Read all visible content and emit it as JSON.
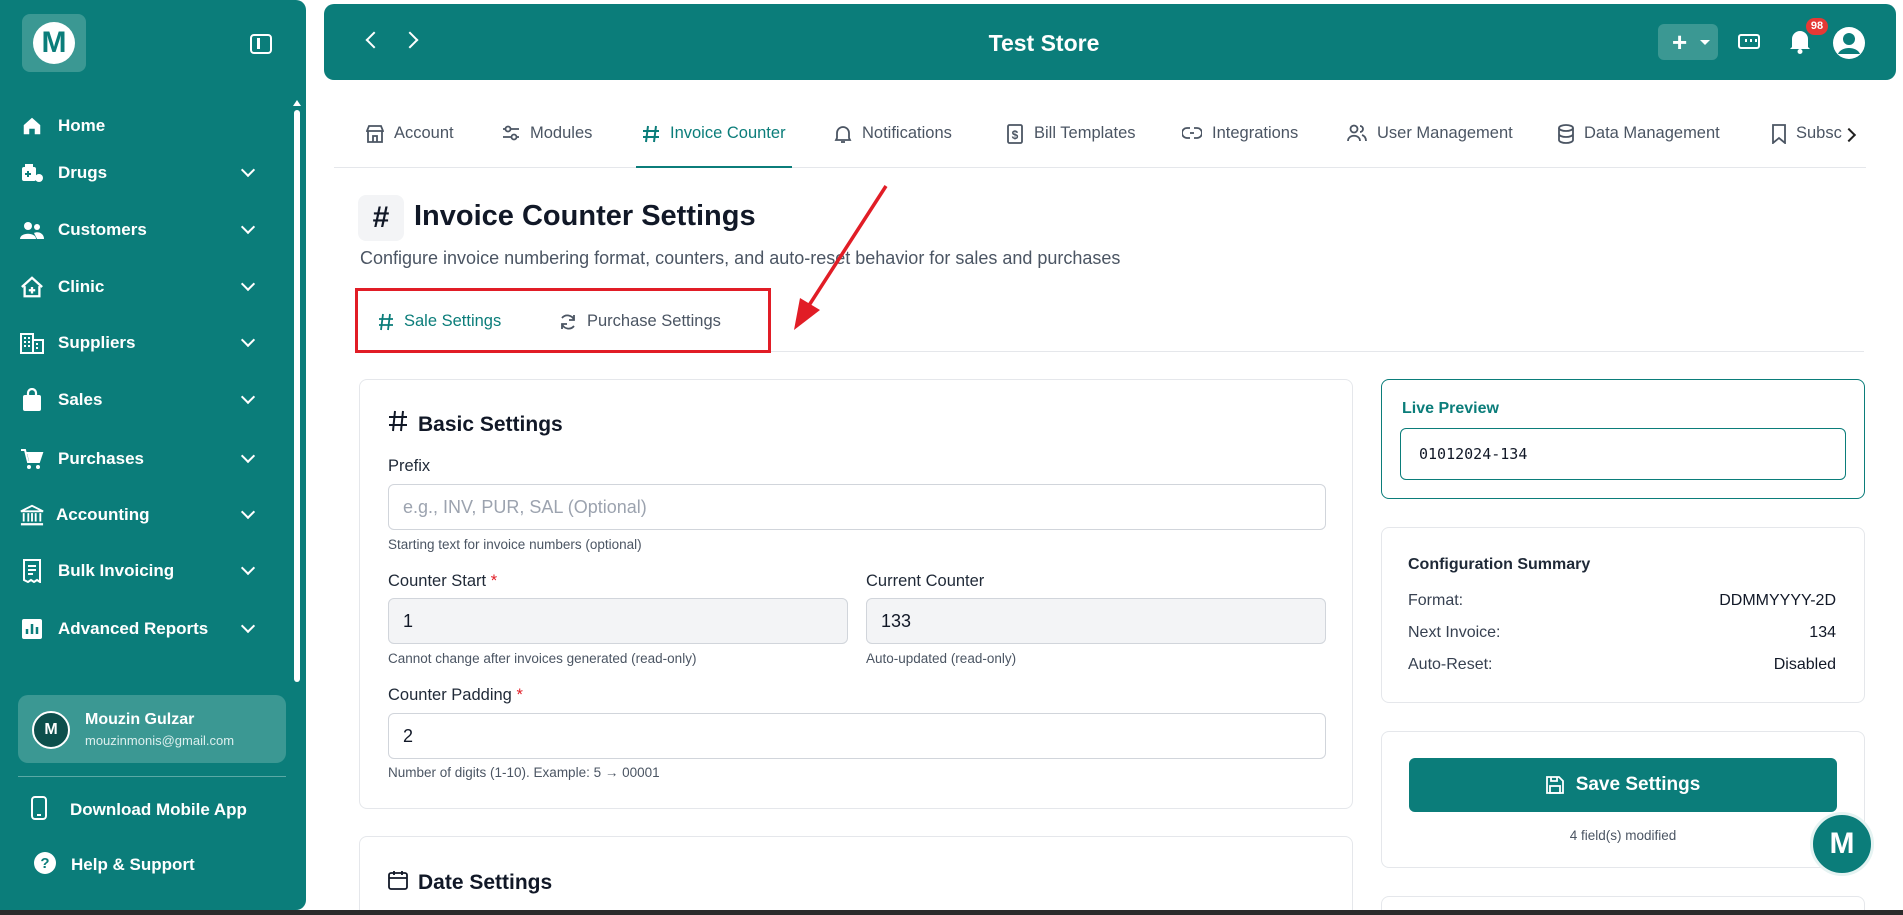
{
  "app": {
    "logo_letter": "M",
    "title": "Test Store",
    "notification_count": "98"
  },
  "sidebar": {
    "items": [
      {
        "label": "Home",
        "icon": "home-icon",
        "expandable": false
      },
      {
        "label": "Drugs",
        "icon": "drugs-icon",
        "expandable": true
      },
      {
        "label": "Customers",
        "icon": "customers-icon",
        "expandable": true
      },
      {
        "label": "Clinic",
        "icon": "clinic-icon",
        "expandable": true
      },
      {
        "label": "Suppliers",
        "icon": "suppliers-icon",
        "expandable": true
      },
      {
        "label": "Sales",
        "icon": "sales-icon",
        "expandable": true
      },
      {
        "label": "Purchases",
        "icon": "cart-icon",
        "expandable": true
      },
      {
        "label": "Accounting",
        "icon": "bank-icon",
        "expandable": true
      },
      {
        "label": "Bulk Invoicing",
        "icon": "invoice-icon",
        "expandable": true
      },
      {
        "label": "Advanced Reports",
        "icon": "reports-icon",
        "expandable": true
      }
    ],
    "user": {
      "initial": "M",
      "name": "Mouzin Gulzar",
      "email": "mouzinmonis@gmail.com"
    },
    "download_app": "Download Mobile App",
    "help": "Help & Support"
  },
  "tabs": [
    {
      "label": "Account",
      "icon": "store-icon"
    },
    {
      "label": "Modules",
      "icon": "sliders-icon"
    },
    {
      "label": "Invoice Counter",
      "icon": "hash-icon",
      "active": true
    },
    {
      "label": "Notifications",
      "icon": "bell-icon"
    },
    {
      "label": "Bill Templates",
      "icon": "dollar-doc-icon"
    },
    {
      "label": "Integrations",
      "icon": "link-icon"
    },
    {
      "label": "User Management",
      "icon": "users-icon"
    },
    {
      "label": "Data Management",
      "icon": "database-icon"
    },
    {
      "label": "Subsc",
      "icon": "bookmark-icon"
    }
  ],
  "page": {
    "title": "Invoice Counter Settings",
    "subtitle": "Configure invoice numbering format, counters, and auto-reset behavior for sales and purchases",
    "subtabs": [
      {
        "label": "Sale Settings",
        "active": true
      },
      {
        "label": "Purchase Settings",
        "active": false
      }
    ]
  },
  "basic_settings": {
    "title": "Basic Settings",
    "prefix_label": "Prefix",
    "prefix_placeholder": "e.g., INV, PUR, SAL (Optional)",
    "prefix_help": "Starting text for invoice numbers (optional)",
    "counter_start_label": "Counter Start",
    "counter_start_value": "1",
    "counter_start_help": "Cannot change after invoices generated (read-only)",
    "current_counter_label": "Current Counter",
    "current_counter_value": "133",
    "current_counter_help": "Auto-updated (read-only)",
    "padding_label": "Counter Padding",
    "padding_value": "2",
    "padding_help": "Number of digits (1-10). Example: 5 → 00001",
    "required_mark": "*"
  },
  "date_settings": {
    "title": "Date Settings"
  },
  "preview": {
    "label": "Live Preview",
    "value": "01012024-134"
  },
  "summary": {
    "title": "Configuration Summary",
    "rows": [
      {
        "label": "Format:",
        "value": "DDMMYYYY-2D"
      },
      {
        "label": "Next Invoice:",
        "value": "134"
      },
      {
        "label": "Auto-Reset:",
        "value": "Disabled"
      }
    ]
  },
  "actions": {
    "save_label": "Save Settings",
    "modified_text": "4 field(s) modified"
  },
  "colors": {
    "brand": "#0b7d7a",
    "highlight": "#e11d26",
    "badge": "#e53935"
  }
}
